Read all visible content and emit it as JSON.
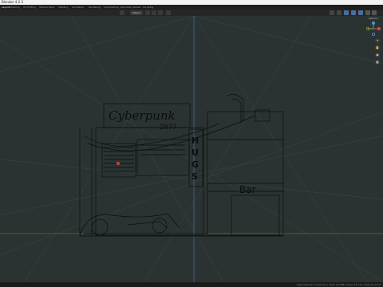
{
  "window": {
    "title": "Blender 4.2.3"
  },
  "menus": [
    "Layout",
    "Modeling",
    "UV Editing",
    "Texture Paint",
    "Shading",
    "Animation",
    "Rendering",
    "Compositing",
    "Geometry Nodes",
    "Scripting"
  ],
  "header": {
    "mode": "Object"
  },
  "sign": {
    "main": "Cyberpunk",
    "sub": "HUGS",
    "bar": "Bar",
    "digits": "2077"
  },
  "status": {
    "info": "Light Cabinet | Collection | Verts 25,488 | Faces 23,121 | Objects 1/117"
  },
  "options_label": "Options",
  "colors": {
    "viewport": "#2b3332",
    "grid": "#3b4645",
    "xaxis": "#5d6e2e",
    "yaxis": "#3a5d8a",
    "wire": "#0b0e0e"
  }
}
